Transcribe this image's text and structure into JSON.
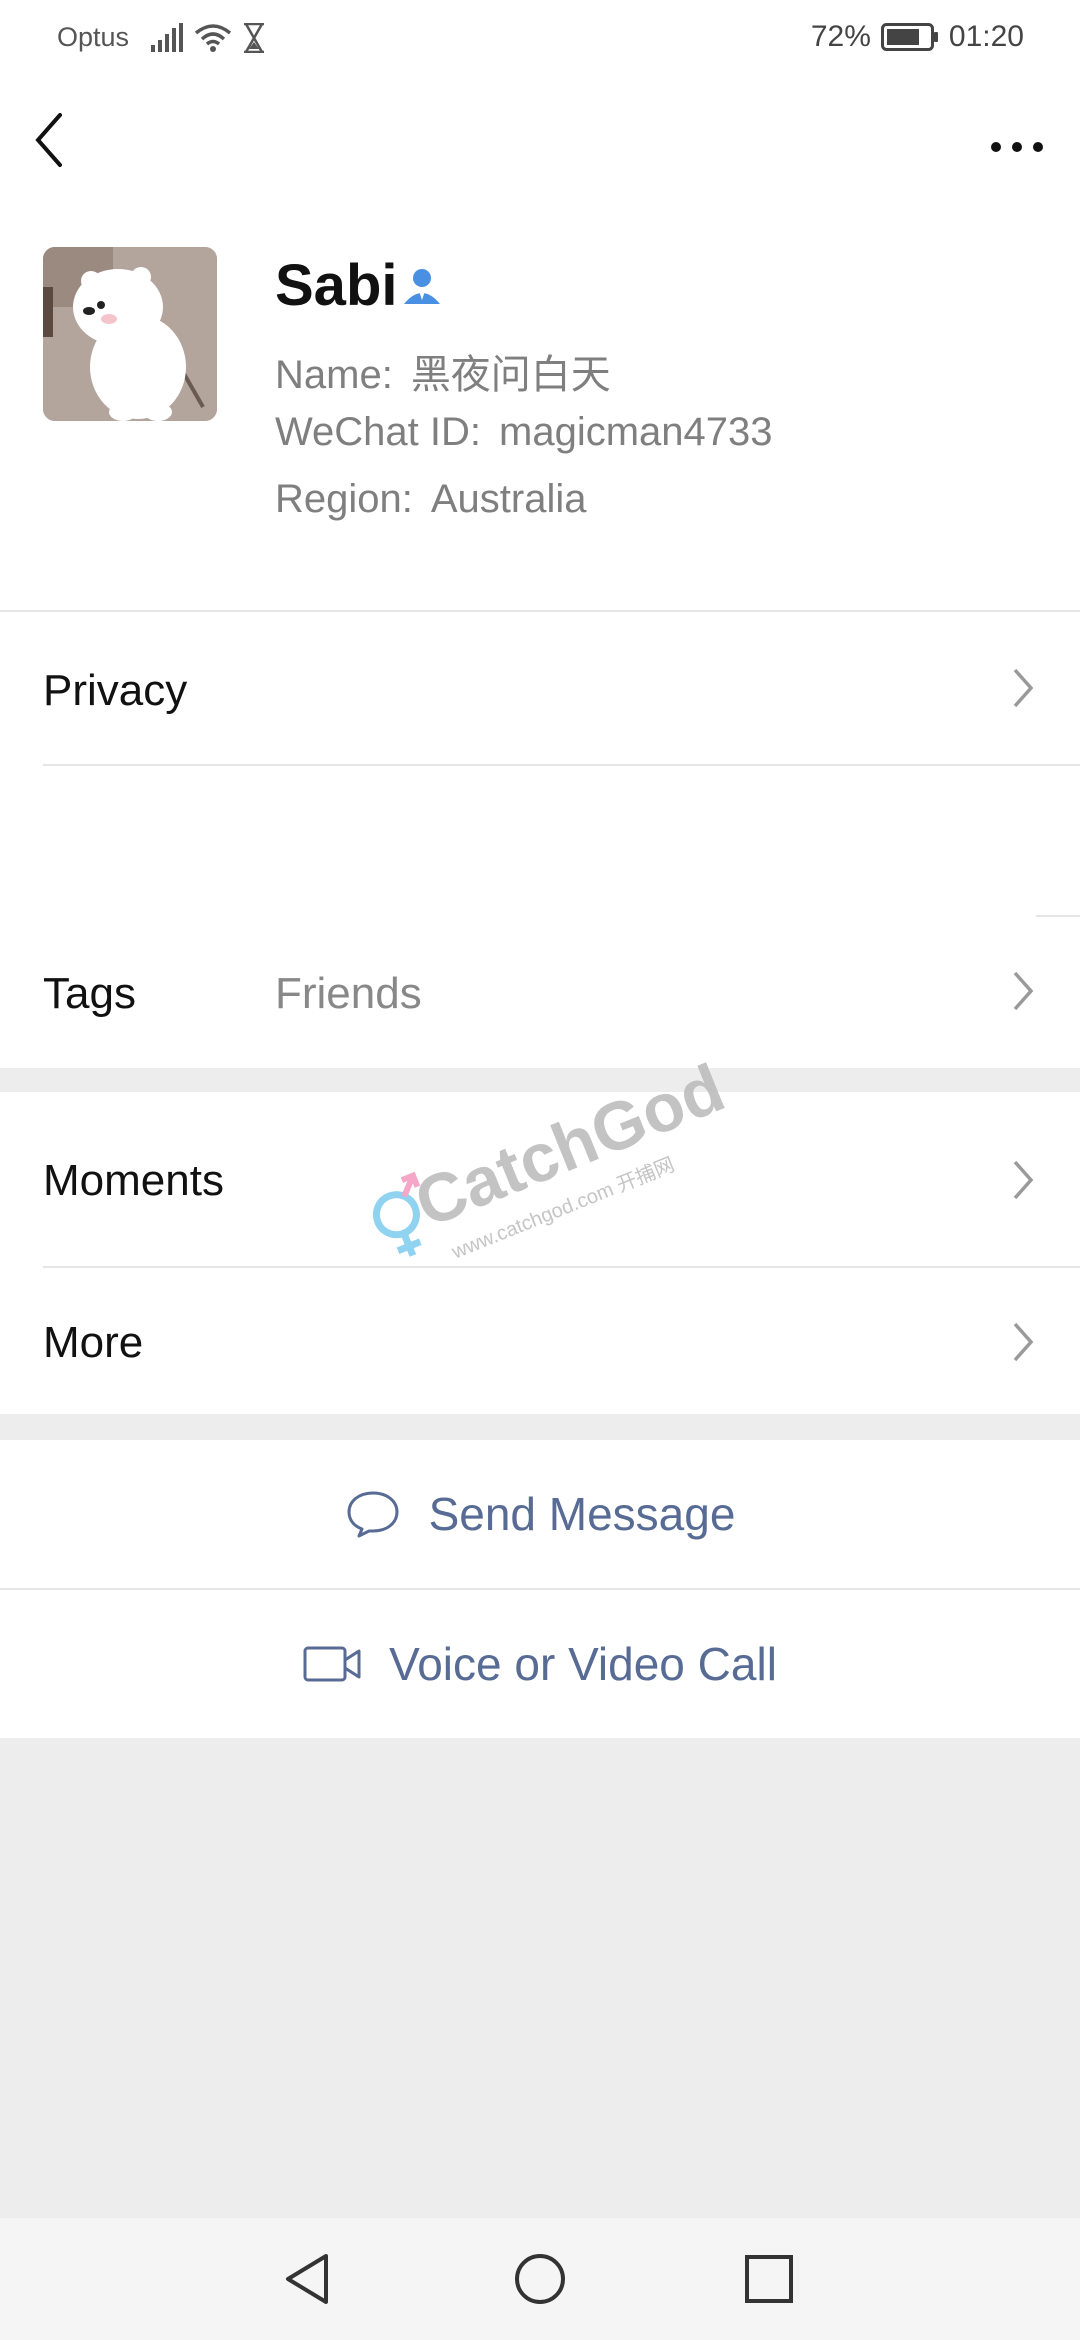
{
  "status_bar": {
    "carrier": "Optus",
    "battery_percent": "72%",
    "time": "01:20",
    "icons": [
      "signal-icon",
      "wifi-icon",
      "hourglass-icon",
      "battery-icon"
    ]
  },
  "top_bar": {
    "back_icon": "chevron-left-icon",
    "more_icon": "more-dots-icon"
  },
  "profile": {
    "display_name": "Sabi",
    "contact_icon": "contact-person-icon",
    "name_label": "Name:",
    "name_value": "黑夜问白天",
    "wechat_id_label": "WeChat ID:",
    "wechat_id_value": "magicman4733",
    "region_label": "Region:",
    "region_value": "Australia"
  },
  "rows": {
    "privacy": "Privacy",
    "tags_label": "Tags",
    "tags_value": "Friends",
    "moments": "Moments",
    "more": "More"
  },
  "actions": {
    "send_message": "Send Message",
    "voice_video_call": "Voice or Video Call"
  },
  "watermark": {
    "brand": "CatchGod",
    "url": "www.catchgod.com 开捕网"
  },
  "colors": {
    "link_blue": "#576b95",
    "background_gray": "#ededed",
    "contact_icon_blue": "#4a90e2"
  }
}
